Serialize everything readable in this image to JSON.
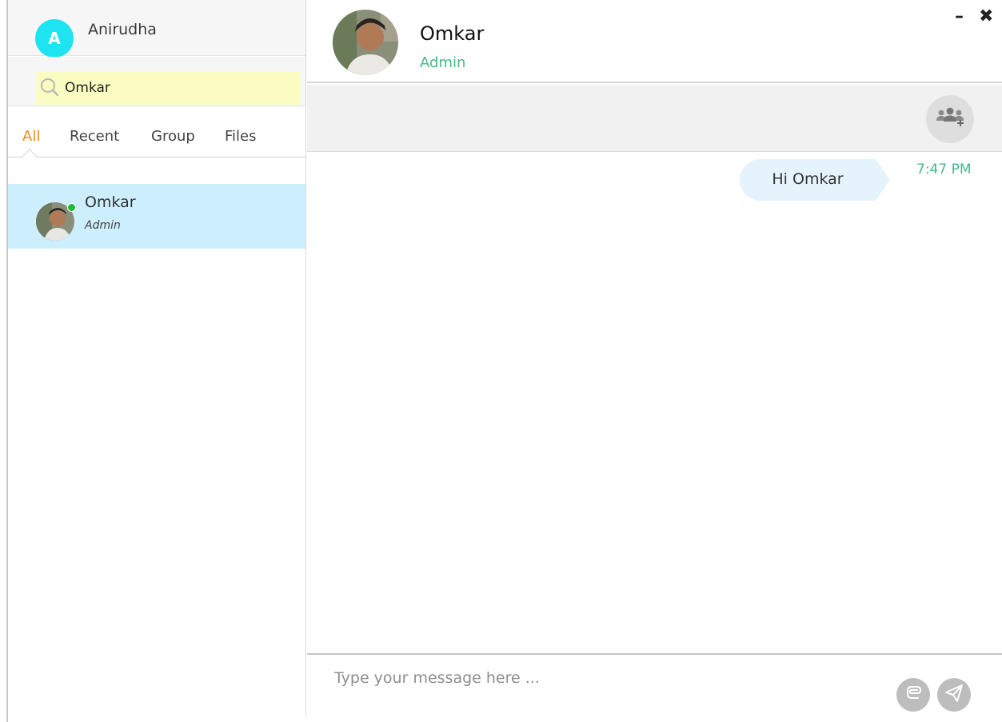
{
  "profile": {
    "initial": "A",
    "name": "Anirudha"
  },
  "search": {
    "value": "Omkar",
    "placeholder": ""
  },
  "tabs": [
    {
      "label": "All",
      "active": true
    },
    {
      "label": "Recent",
      "active": false
    },
    {
      "label": "Group",
      "active": false
    },
    {
      "label": "Files",
      "active": false
    }
  ],
  "contacts": [
    {
      "name": "Omkar",
      "role": "Admin",
      "online": true,
      "selected": true
    }
  ],
  "chat": {
    "name": "Omkar",
    "role": "Admin",
    "minimize_glyph": "–",
    "close_glyph": "✖",
    "messages": [
      {
        "text": "Hi Omkar",
        "time": "7:47 PM",
        "outgoing": true
      }
    ],
    "composer_placeholder": "Type your message here ..."
  },
  "icons": {
    "search": "search-icon",
    "add_group": "add-group-icon",
    "attach": "paperclip-icon",
    "send": "paper-plane-icon"
  },
  "colors": {
    "avatar_bg": "#1ee3f0",
    "active_tab": "#f08a1a",
    "selected_contact": "#cdeefc",
    "online": "#1dbb36",
    "role_text": "#48b887",
    "search_bg": "#fafcc1",
    "bubble_bg": "#e5f4fc"
  }
}
